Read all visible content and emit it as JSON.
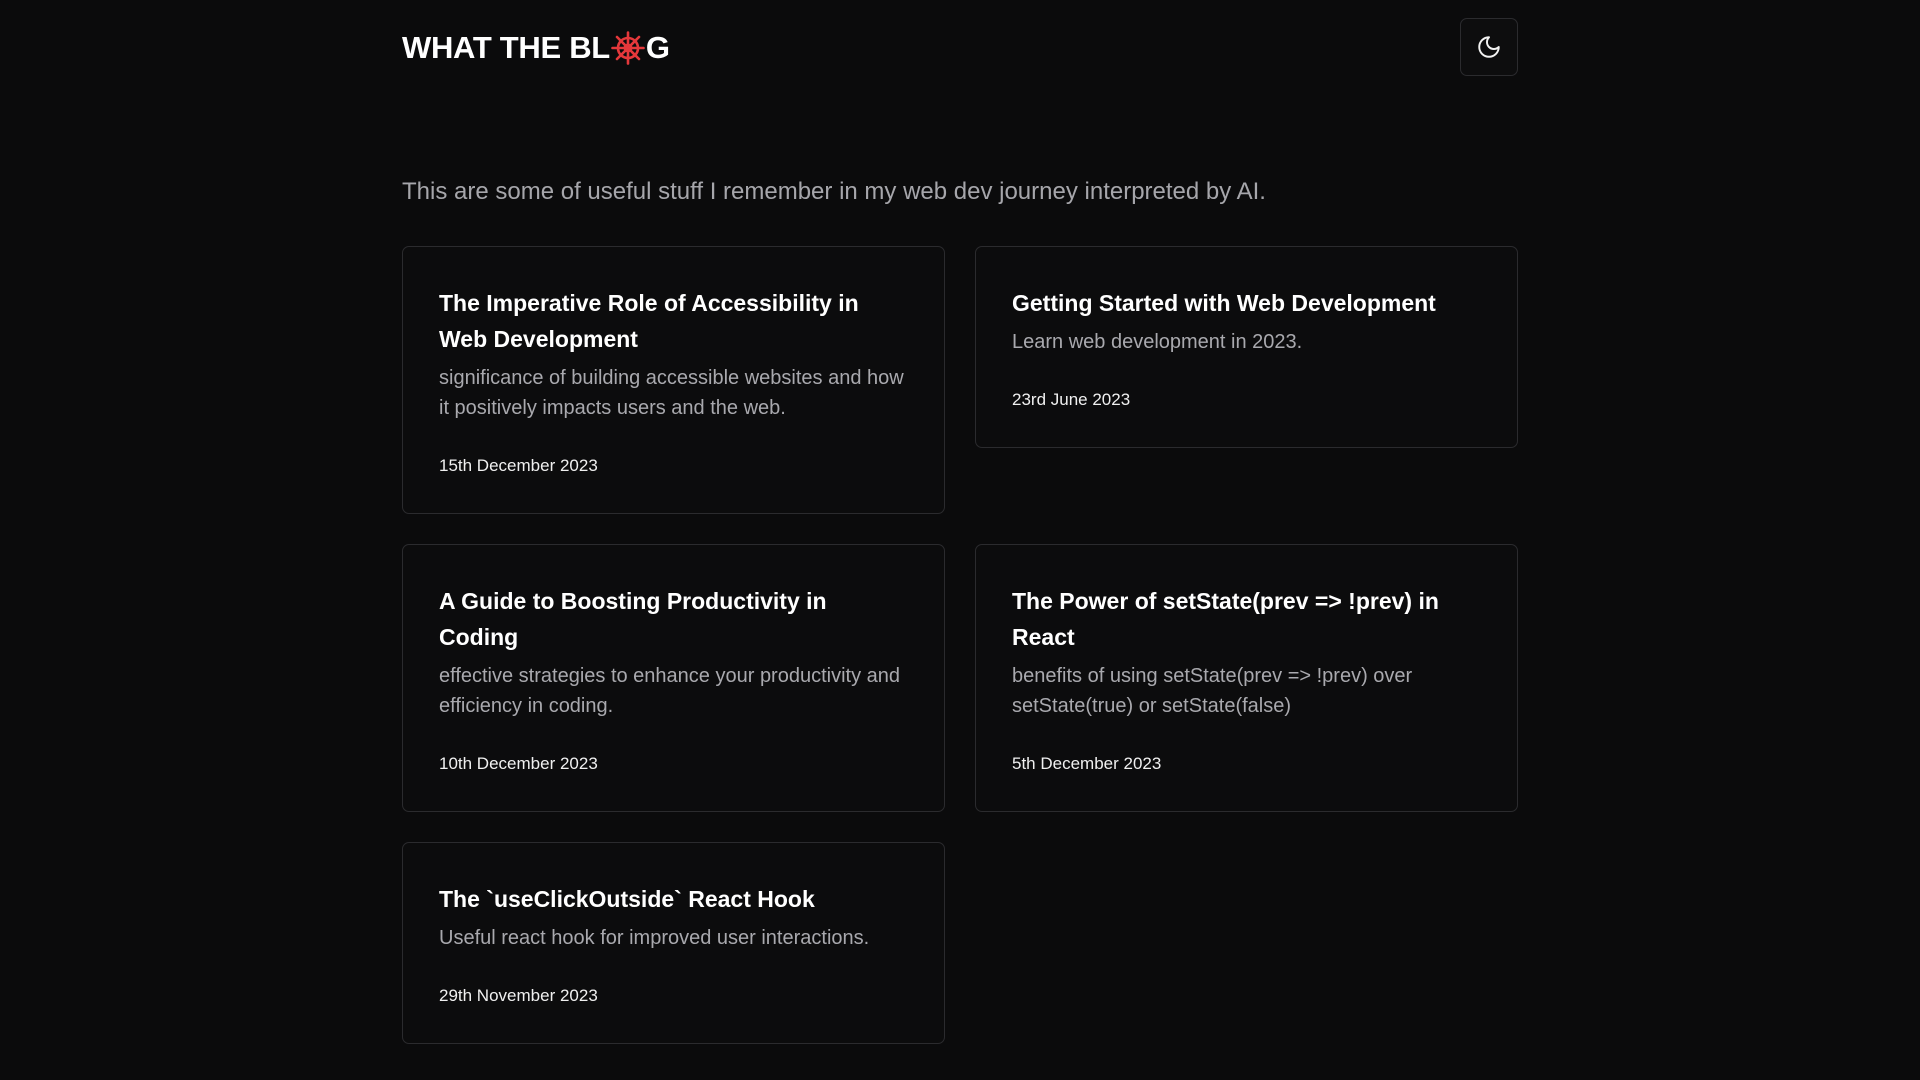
{
  "header": {
    "logo_prefix": "WHAT THE BL",
    "logo_suffix": "G",
    "logo_wheel_icon": "ship-wheel-icon",
    "logo_accent_color": "#e5383b",
    "theme_toggle_icon": "moon-icon"
  },
  "intro": "This are some of useful stuff I remember in my web dev journey interpreted by AI.",
  "posts": [
    {
      "title": "The Imperative Role of Accessibility in Web Development",
      "description": "significance of building accessible websites and how it positively impacts users and the web.",
      "date": "15th December 2023"
    },
    {
      "title": "Getting Started with Web Development",
      "description": "Learn web development in 2023.",
      "date": "23rd June 2023"
    },
    {
      "title": "A Guide to Boosting Productivity in Coding",
      "description": "effective strategies to enhance your productivity and efficiency in coding.",
      "date": "10th December 2023"
    },
    {
      "title": "The Power of setState(prev => !prev) in React",
      "description": "benefits of using setState(prev => !prev) over setState(true) or setState(false)",
      "date": "5th December 2023"
    },
    {
      "title": "The `useClickOutside` React Hook",
      "description": "Useful react hook for improved user interactions.",
      "date": "29th November 2023"
    }
  ]
}
